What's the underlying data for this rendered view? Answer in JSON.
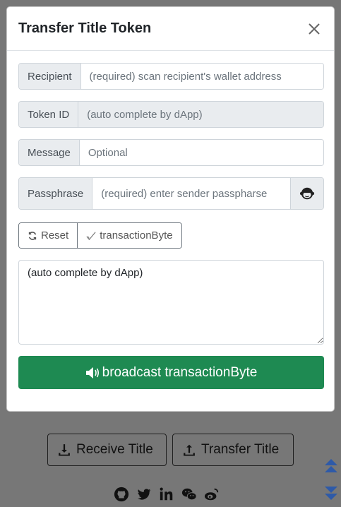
{
  "modal": {
    "title": "Transfer Title Token",
    "recipient": {
      "label": "Recipient",
      "placeholder": "(required) scan recipient's wallet address"
    },
    "token_id": {
      "label": "Token ID",
      "placeholder": "(auto complete by dApp)"
    },
    "message": {
      "label": "Message",
      "placeholder": "Optional"
    },
    "passphrase": {
      "label": "Passphrase",
      "placeholder": "(required) enter sender passpharse",
      "toggle_icon": "monkey-face-icon"
    },
    "reset_label": "Reset",
    "transaction_byte_label": "transactionByte",
    "textarea_value": "(auto complete by dApp)",
    "broadcast_label": "broadcast transactionByte"
  },
  "background": {
    "receive_label": "Receive Title",
    "transfer_label": "Transfer Title",
    "social_icons": [
      "github-icon",
      "twitter-icon",
      "linkedin-icon",
      "wechat-icon",
      "weibo-icon"
    ]
  },
  "colors": {
    "primary_green": "#1e8a52",
    "overlay": "#777777"
  }
}
